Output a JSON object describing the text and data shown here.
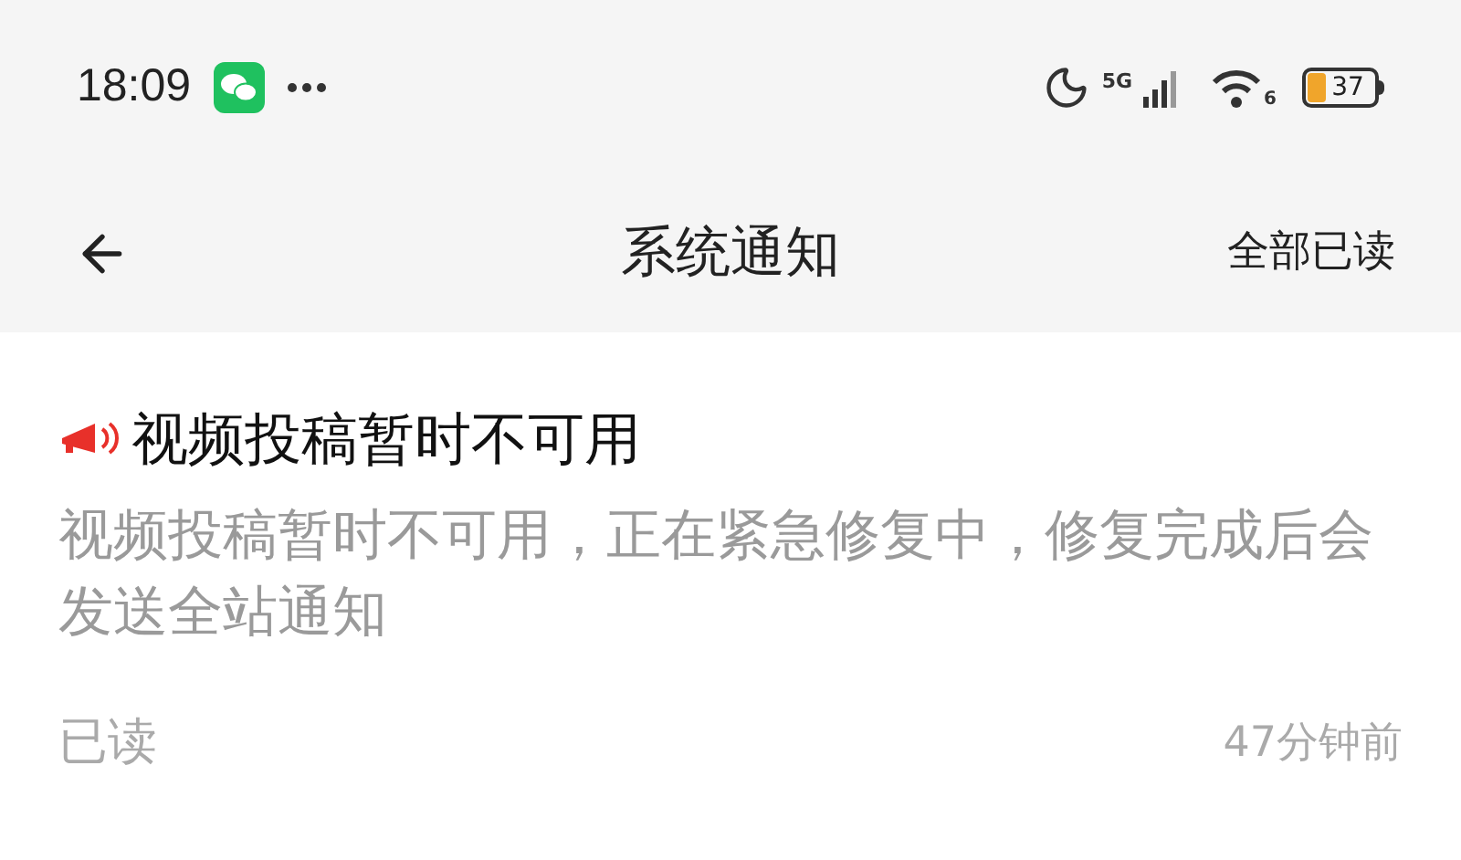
{
  "status_bar": {
    "time": "18:09",
    "network": "5G",
    "wifi_band": "6",
    "battery": "37"
  },
  "header": {
    "title": "系统通知",
    "action": "全部已读"
  },
  "notifications": [
    {
      "title": "视频投稿暂时不可用",
      "body": "视频投稿暂时不可用，正在紧急修复中，修复完成后会发送全站通知",
      "status": "已读",
      "time": "47分钟前"
    }
  ]
}
